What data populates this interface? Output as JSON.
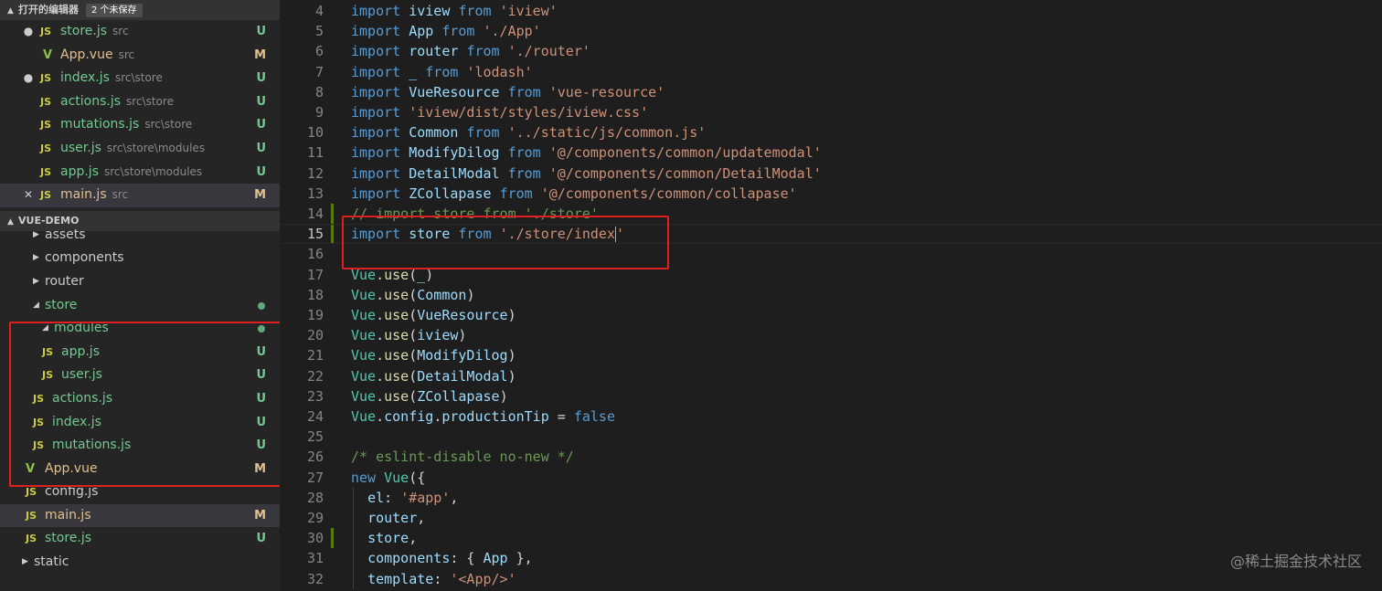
{
  "open_editors": {
    "title": "打开的编辑器",
    "badge": "2 个未保存",
    "items": [
      {
        "icon": "JS",
        "name": "store.js",
        "desc": "src",
        "status": "U",
        "unsaved": true
      },
      {
        "icon": "V",
        "name": "App.vue",
        "desc": "src",
        "status": "M",
        "unsaved": false
      },
      {
        "icon": "JS",
        "name": "index.js",
        "desc": "src\\store",
        "status": "U",
        "unsaved": true
      },
      {
        "icon": "JS",
        "name": "actions.js",
        "desc": "src\\store",
        "status": "U",
        "unsaved": false
      },
      {
        "icon": "JS",
        "name": "mutations.js",
        "desc": "src\\store",
        "status": "U",
        "unsaved": false
      },
      {
        "icon": "JS",
        "name": "user.js",
        "desc": "src\\store\\modules",
        "status": "U",
        "unsaved": false
      },
      {
        "icon": "JS",
        "name": "app.js",
        "desc": "src\\store\\modules",
        "status": "U",
        "unsaved": false
      },
      {
        "icon": "JS",
        "name": "main.js",
        "desc": "src",
        "status": "M",
        "close": "✕"
      }
    ]
  },
  "project": {
    "title": "VUE-DEMO",
    "tree": [
      {
        "name": "assets",
        "type": "folder"
      },
      {
        "name": "components",
        "type": "folder"
      },
      {
        "name": "router",
        "type": "folder"
      },
      {
        "name": "store",
        "type": "folder-open"
      },
      {
        "name": "modules",
        "type": "folder-open"
      },
      {
        "name": "app.js",
        "type": "js",
        "status": "U"
      },
      {
        "name": "user.js",
        "type": "js",
        "status": "U"
      },
      {
        "name": "actions.js",
        "type": "js",
        "status": "U"
      },
      {
        "name": "index.js",
        "type": "js",
        "status": "U"
      },
      {
        "name": "mutations.js",
        "type": "js",
        "status": "U"
      },
      {
        "name": "App.vue",
        "type": "vue",
        "status": "M"
      },
      {
        "name": "config.js",
        "type": "js"
      },
      {
        "name": "main.js",
        "type": "js",
        "status": "M"
      },
      {
        "name": "store.js",
        "type": "js",
        "status": "U"
      },
      {
        "name": "static",
        "type": "folder"
      }
    ]
  },
  "editor": {
    "lines": [
      {
        "n": "4",
        "code": "import iview from 'iview'"
      },
      {
        "n": "5",
        "code": "import App from './App'"
      },
      {
        "n": "6",
        "code": "import router from './router'"
      },
      {
        "n": "7",
        "code": "import _ from 'lodash'"
      },
      {
        "n": "8",
        "code": "import VueResource from 'vue-resource'"
      },
      {
        "n": "9",
        "code": "import 'iview/dist/styles/iview.css'"
      },
      {
        "n": "10",
        "code": "import Common from '../static/js/common.js'"
      },
      {
        "n": "11",
        "code": "import ModifyDilog from '@/components/common/updatemodal'"
      },
      {
        "n": "12",
        "code": "import DetailModal from '@/components/common/DetailModal'"
      },
      {
        "n": "13",
        "code": "import ZCollapase from '@/components/common/collapase'"
      },
      {
        "n": "14",
        "code": "// import store from './store'"
      },
      {
        "n": "15",
        "code": "import store from './store/index'"
      },
      {
        "n": "16",
        "code": ""
      },
      {
        "n": "17",
        "code": "Vue.use(_)"
      },
      {
        "n": "18",
        "code": "Vue.use(Common)"
      },
      {
        "n": "19",
        "code": "Vue.use(VueResource)"
      },
      {
        "n": "20",
        "code": "Vue.use(iview)"
      },
      {
        "n": "21",
        "code": "Vue.use(ModifyDilog)"
      },
      {
        "n": "22",
        "code": "Vue.use(DetailModal)"
      },
      {
        "n": "23",
        "code": "Vue.use(ZCollapase)"
      },
      {
        "n": "24",
        "code": "Vue.config.productionTip = false"
      },
      {
        "n": "25",
        "code": ""
      },
      {
        "n": "26",
        "code": "/* eslint-disable no-new */"
      },
      {
        "n": "27",
        "code": "new Vue({"
      },
      {
        "n": "28",
        "code": "  el: '#app',"
      },
      {
        "n": "29",
        "code": "  router,"
      },
      {
        "n": "30",
        "code": "  store,"
      },
      {
        "n": "31",
        "code": "  components: { App },"
      },
      {
        "n": "32",
        "code": "  template: '<App/>'"
      }
    ]
  },
  "watermark": "@稀土掘金技术社区",
  "colors": {
    "sidebar_bg": "#252526",
    "editor_bg": "#1e1e1e",
    "untracked": "#73c991",
    "modified": "#e2c08d",
    "highlight_border": "#e02020"
  }
}
